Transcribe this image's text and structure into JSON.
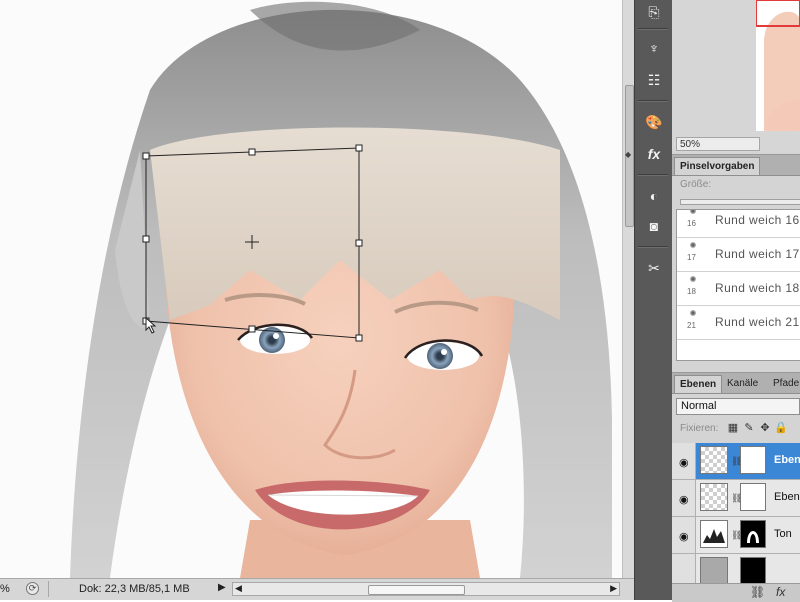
{
  "status_bar": {
    "zoom": "%",
    "doc_info": "Dok: 22,3 MB/85,1 MB"
  },
  "navigator": {
    "zoom": "50%"
  },
  "brush_panel": {
    "tab_label": "Pinselvorgaben",
    "size_label": "Größe:",
    "brushes": [
      {
        "size": "16",
        "name": "Rund weich 16"
      },
      {
        "size": "17",
        "name": "Rund weich 17"
      },
      {
        "size": "18",
        "name": "Rund weich 18"
      },
      {
        "size": "21",
        "name": "Rund weich 21"
      }
    ]
  },
  "layers_panel": {
    "tabs": [
      "Ebenen",
      "Kanäle",
      "Pfade"
    ],
    "blend_mode": "Normal",
    "lock_label": "Fixieren:",
    "layers": [
      {
        "name": "Ebene",
        "selected": true
      },
      {
        "name": "Ebene",
        "selected": false
      },
      {
        "name": "Ton",
        "selected": false
      }
    ],
    "footer_fx": "fx"
  },
  "icons": {
    "accent": "#3b87d6",
    "transform_handle_color": "#222222"
  }
}
